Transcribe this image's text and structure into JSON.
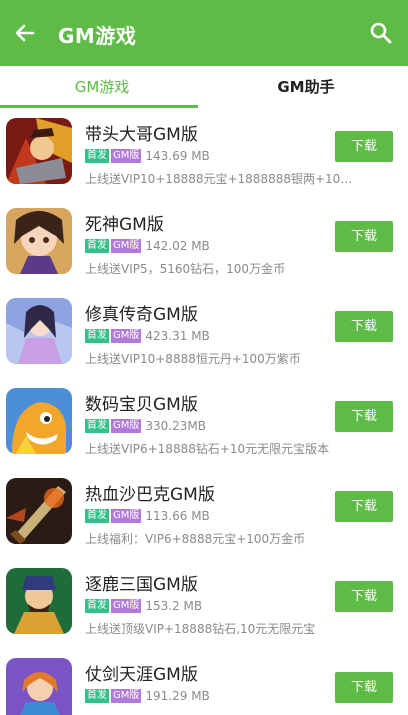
{
  "header": {
    "title": "GM游戏",
    "back_icon": "back-arrow-icon",
    "search_icon": "search-icon",
    "accent": "#5dbb46"
  },
  "tabs": [
    {
      "label": "GM游戏",
      "active": true
    },
    {
      "label": "GM助手",
      "active": false
    }
  ],
  "games": [
    {
      "name": "带头大哥GM版",
      "tag1": "首发",
      "tag2": "GM版",
      "size": "143.69 MB",
      "desc": "上线送VIP10+18888元宝+1888888银两+10元无…",
      "button": "下载"
    },
    {
      "name": "死神GM版",
      "tag1": "首发",
      "tag2": "GM版",
      "size": "142.02 MB",
      "desc": "上线送VIP5，5160钻石，100万金币",
      "button": "下载"
    },
    {
      "name": "修真传奇GM版",
      "tag1": "首发",
      "tag2": "GM版",
      "size": "423.31 MB",
      "desc": "上线送VIP10+8888恒元丹+100万紫币",
      "button": "下载"
    },
    {
      "name": "数码宝贝GM版",
      "tag1": "首发",
      "tag2": "GM版",
      "size": "330.23MB",
      "desc": "上线送VIP6+18888钻石+10元无限元宝版本",
      "button": "下载"
    },
    {
      "name": "热血沙巴克GM版",
      "tag1": "首发",
      "tag2": "GM版",
      "size": "113.66 MB",
      "desc": "上线福利：VIP6+8888元宝+100万金币",
      "button": "下载"
    },
    {
      "name": "逐鹿三国GM版",
      "tag1": "首发",
      "tag2": "GM版",
      "size": "153.2 MB",
      "desc": "上线送顶级VIP+18888钻石,10元无限元宝",
      "button": "下载"
    },
    {
      "name": "仗剑天涯GM版",
      "tag1": "首发",
      "tag2": "GM版",
      "size": "191.29 MB",
      "desc": "",
      "button": "下载"
    }
  ]
}
